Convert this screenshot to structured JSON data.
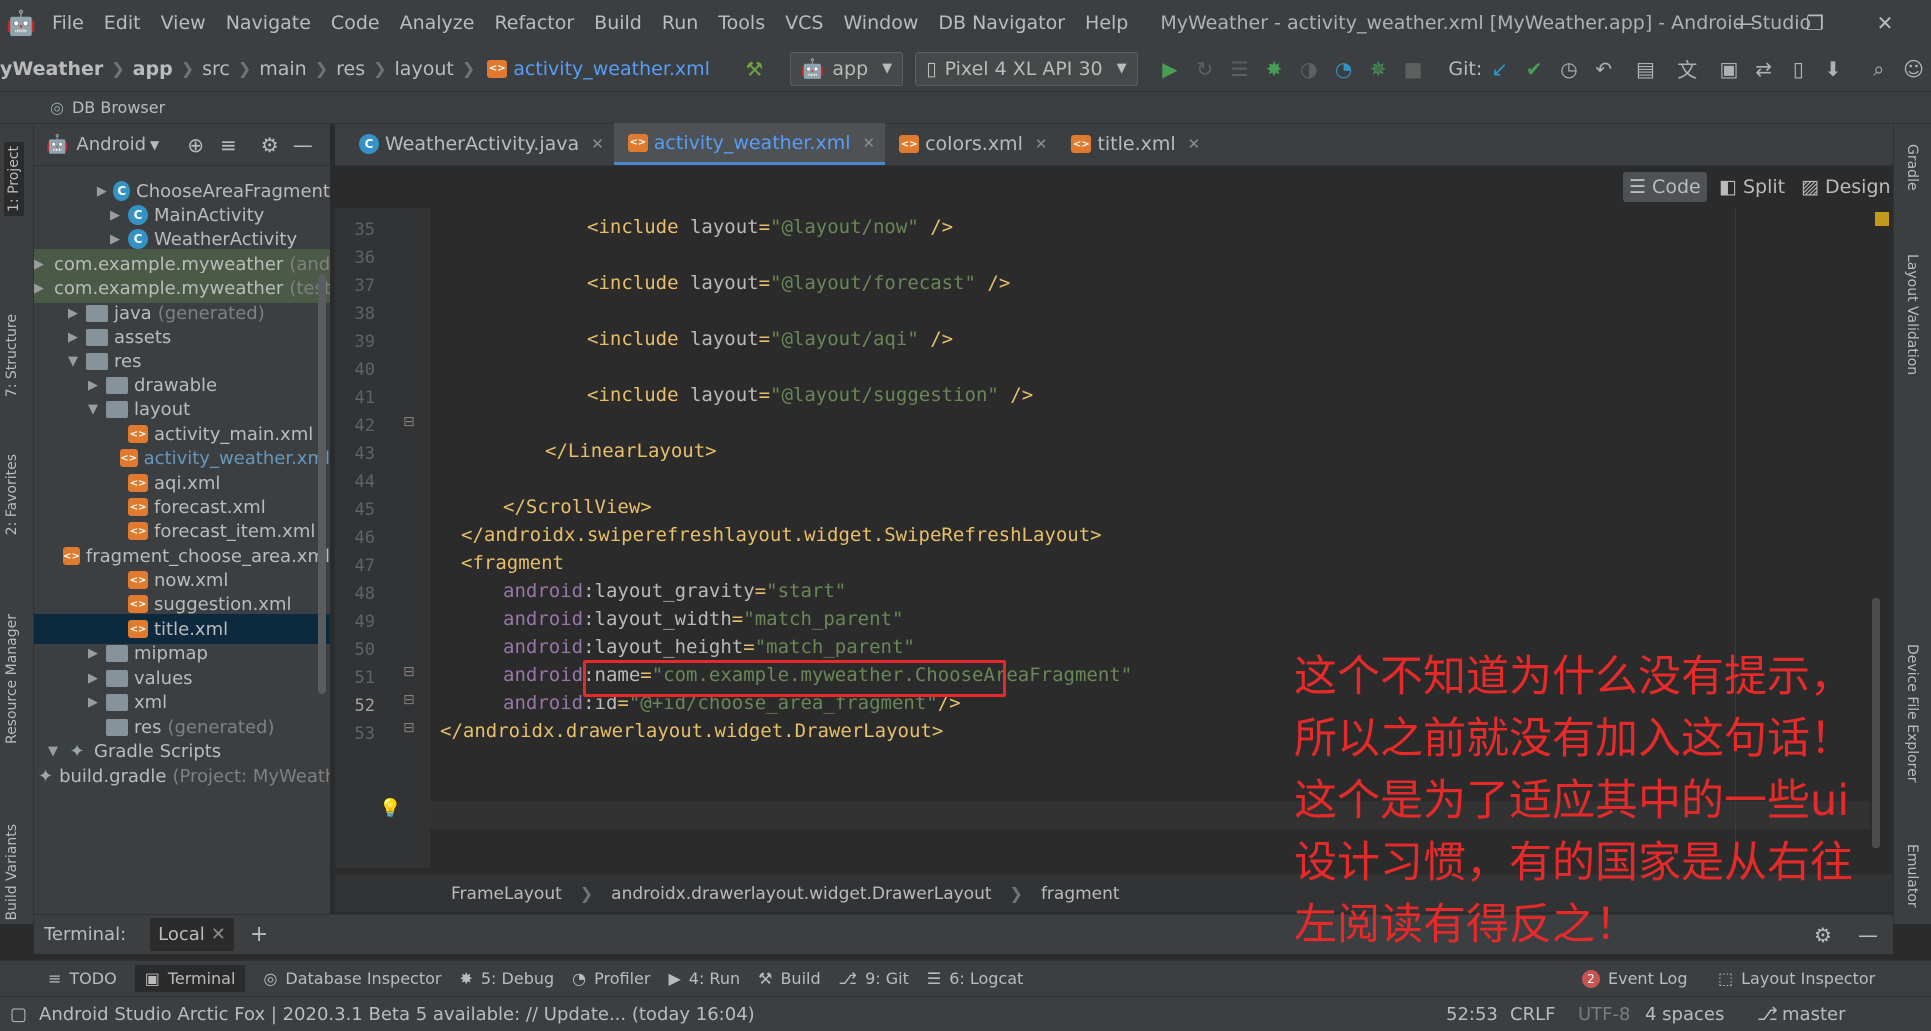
{
  "menubar": {
    "items": [
      "File",
      "Edit",
      "View",
      "Navigate",
      "Code",
      "Analyze",
      "Refactor",
      "Build",
      "Run",
      "Tools",
      "VCS",
      "Window",
      "DB Navigator",
      "Help"
    ],
    "title": "MyWeather - activity_weather.xml [MyWeather.app] - Android Studio",
    "minimize": "—",
    "maximize": "❐",
    "close": "✕"
  },
  "navbar": {
    "breadcrumbs": [
      "yWeather",
      "app",
      "src",
      "main",
      "res",
      "layout",
      "activity_weather.xml"
    ],
    "run_config": "app",
    "device": "Pixel 4 XL API 30",
    "git_label": "Git:"
  },
  "db_browser": {
    "label": "DB Browser"
  },
  "left_strip": {
    "tabs": [
      "1: Project",
      "7: Structure",
      "2: Favorites",
      "Resource Manager",
      "Build Variants"
    ]
  },
  "right_strip": {
    "tabs": [
      "Gradle",
      "Layout Validation",
      "Device File Explorer",
      "Emulator"
    ]
  },
  "project": {
    "view": "Android",
    "tree": [
      {
        "label": "ChooseAreaFragment",
        "icon": "class",
        "indent": 3,
        "arrow": "▶"
      },
      {
        "label": "MainActivity",
        "icon": "class",
        "indent": 3,
        "arrow": "▶"
      },
      {
        "label": "WeatherActivity",
        "icon": "class",
        "indent": 3,
        "arrow": "▶"
      },
      {
        "label": "com.example.myweather",
        "icon": "folder",
        "indent": 2,
        "arrow": "▶",
        "suffix": "(androidTest)"
      },
      {
        "label": "com.example.myweather",
        "icon": "folder",
        "indent": 2,
        "arrow": "▶",
        "suffix": "(test)"
      },
      {
        "label": "java",
        "icon": "folder",
        "indent": 1,
        "arrow": "▶",
        "suffix": "(generated)"
      },
      {
        "label": "assets",
        "icon": "folder",
        "indent": 1,
        "arrow": "▶"
      },
      {
        "label": "res",
        "icon": "folder",
        "indent": 1,
        "arrow": "▼"
      },
      {
        "label": "drawable",
        "icon": "folder",
        "indent": 2,
        "arrow": "▶"
      },
      {
        "label": "layout",
        "icon": "folder",
        "indent": 2,
        "arrow": "▼"
      },
      {
        "label": "activity_main.xml",
        "icon": "xml",
        "indent": 3
      },
      {
        "label": "activity_weather.xml",
        "icon": "xml",
        "indent": 3
      },
      {
        "label": "aqi.xml",
        "icon": "xml",
        "indent": 3
      },
      {
        "label": "forecast.xml",
        "icon": "xml",
        "indent": 3
      },
      {
        "label": "forecast_item.xml",
        "icon": "xml",
        "indent": 3
      },
      {
        "label": "fragment_choose_area.xml",
        "icon": "xml",
        "indent": 3
      },
      {
        "label": "now.xml",
        "icon": "xml",
        "indent": 3
      },
      {
        "label": "suggestion.xml",
        "icon": "xml",
        "indent": 3
      },
      {
        "label": "title.xml",
        "icon": "xml",
        "indent": 3
      },
      {
        "label": "mipmap",
        "icon": "folder",
        "indent": 2,
        "arrow": "▶"
      },
      {
        "label": "values",
        "icon": "folder",
        "indent": 2,
        "arrow": "▶"
      },
      {
        "label": "xml",
        "icon": "folder",
        "indent": 2,
        "arrow": "▶"
      },
      {
        "label": "res",
        "icon": "folder",
        "indent": 2,
        "suffix": "(generated)"
      },
      {
        "label": "Gradle Scripts",
        "icon": "gradle",
        "indent": 0,
        "arrow": "▼"
      },
      {
        "label": "build.gradle",
        "icon": "gradle",
        "indent": 2,
        "suffix": "(Project: MyWeather)"
      }
    ]
  },
  "tabs": [
    {
      "label": "WeatherActivity.java",
      "icon": "class"
    },
    {
      "label": "activity_weather.xml",
      "icon": "xml"
    },
    {
      "label": "colors.xml",
      "icon": "xml"
    },
    {
      "label": "title.xml",
      "icon": "xml"
    }
  ],
  "view_modes": [
    "Code",
    "Split",
    "Design"
  ],
  "editor": {
    "lines": [
      {
        "n": "35",
        "code": [
          [
            "br",
            "<include "
          ],
          [
            "attr",
            "layout"
          ],
          [
            "br",
            "="
          ],
          [
            "val",
            "\"@layout/now\""
          ],
          [
            "br",
            " />"
          ]
        ],
        "indent": 7
      },
      {
        "n": "36",
        "code": [],
        "indent": 0
      },
      {
        "n": "37",
        "code": [
          [
            "br",
            "<include "
          ],
          [
            "attr",
            "layout"
          ],
          [
            "br",
            "="
          ],
          [
            "val",
            "\"@layout/forecast\""
          ],
          [
            "br",
            " />"
          ]
        ],
        "indent": 7
      },
      {
        "n": "38",
        "code": [],
        "indent": 0
      },
      {
        "n": "39",
        "code": [
          [
            "br",
            "<include "
          ],
          [
            "attr",
            "layout"
          ],
          [
            "br",
            "="
          ],
          [
            "val",
            "\"@layout/aqi\""
          ],
          [
            "br",
            " />"
          ]
        ],
        "indent": 7
      },
      {
        "n": "40",
        "code": [],
        "indent": 0
      },
      {
        "n": "41",
        "code": [
          [
            "br",
            "<include "
          ],
          [
            "attr",
            "layout"
          ],
          [
            "br",
            "="
          ],
          [
            "val",
            "\"@layout/suggestion\""
          ],
          [
            "br",
            " />"
          ]
        ],
        "indent": 7
      },
      {
        "n": "42",
        "code": [],
        "indent": 0
      },
      {
        "n": "43",
        "code": [
          [
            "br",
            "</LinearLayout>"
          ]
        ],
        "indent": 5
      },
      {
        "n": "44",
        "code": [],
        "indent": 0
      },
      {
        "n": "45",
        "code": [
          [
            "br",
            "</ScrollView>"
          ]
        ],
        "indent": 3
      },
      {
        "n": "46",
        "code": [
          [
            "br",
            "</androidx.swiperefreshlayout.widget.SwipeRefreshLayout>"
          ]
        ],
        "indent": 1
      },
      {
        "n": "47",
        "code": [
          [
            "br",
            "<fragment"
          ]
        ],
        "indent": 1
      },
      {
        "n": "48",
        "code": [
          [
            "ns",
            "android"
          ],
          [
            "attr",
            ":layout_gravity"
          ],
          [
            "br",
            "="
          ],
          [
            "val",
            "\"start\""
          ]
        ],
        "indent": 3
      },
      {
        "n": "49",
        "code": [
          [
            "ns",
            "android"
          ],
          [
            "attr",
            ":layout_width"
          ],
          [
            "br",
            "="
          ],
          [
            "val",
            "\"match_parent\""
          ]
        ],
        "indent": 3
      },
      {
        "n": "50",
        "code": [
          [
            "ns",
            "android"
          ],
          [
            "attr",
            ":layout_height"
          ],
          [
            "br",
            "="
          ],
          [
            "val",
            "\"match_parent\""
          ]
        ],
        "indent": 3
      },
      {
        "n": "51",
        "code": [
          [
            "ns",
            "android"
          ],
          [
            "attr",
            ":name"
          ],
          [
            "br",
            "="
          ],
          [
            "val",
            "\"com.example.myweather.ChooseAreaFragment\""
          ]
        ],
        "indent": 3
      },
      {
        "n": "52",
        "code": [
          [
            "ns",
            "android"
          ],
          [
            "attr",
            ":id"
          ],
          [
            "br",
            "="
          ],
          [
            "val",
            "\"@+id/choose_area_fragment\""
          ],
          [
            "br",
            "/>"
          ]
        ],
        "indent": 3
      },
      {
        "n": "53",
        "code": [
          [
            "br",
            "</androidx.drawerlayout.widget.DrawerLayout>"
          ]
        ],
        "indent": 0
      }
    ]
  },
  "structure_breadcrumb": [
    "FrameLayout",
    "androidx.drawerlayout.widget.DrawerLayout",
    "fragment"
  ],
  "terminal": {
    "title": "Terminal:",
    "tab": "Local"
  },
  "bottom_tools": [
    {
      "label": "TODO",
      "icon": "list-icon"
    },
    {
      "label": "Terminal",
      "icon": "terminal-icon",
      "active": true
    },
    {
      "label": "Database Inspector",
      "icon": "database-icon"
    },
    {
      "label": "5: Debug",
      "icon": "bug-icon"
    },
    {
      "label": "Profiler",
      "icon": "gauge-icon"
    },
    {
      "label": "4: Run",
      "icon": "run-icon"
    },
    {
      "label": "Build",
      "icon": "hammer-icon"
    },
    {
      "label": "9: Git",
      "icon": "branch-icon"
    },
    {
      "label": "6: Logcat",
      "icon": "logcat-icon"
    }
  ],
  "event_log": {
    "count": "2",
    "label": "Event Log"
  },
  "layout_inspector": "Layout Inspector",
  "status": {
    "message": "Android Studio Arctic Fox | 2020.3.1 Beta 5 available: // Update... (today 16:04)",
    "position": "52:53",
    "line_sep": "CRLF",
    "encoding": "UTF-8",
    "indent": "4 spaces",
    "branch": "master"
  },
  "annotation": {
    "lines": [
      "这个不知道为什么没有提示，",
      "所以之前就没有加入这句话！",
      "这个是为了适应其中的一些ui",
      "设计习惯，有的国家是从右往",
      "左阅读有得反之！"
    ]
  }
}
